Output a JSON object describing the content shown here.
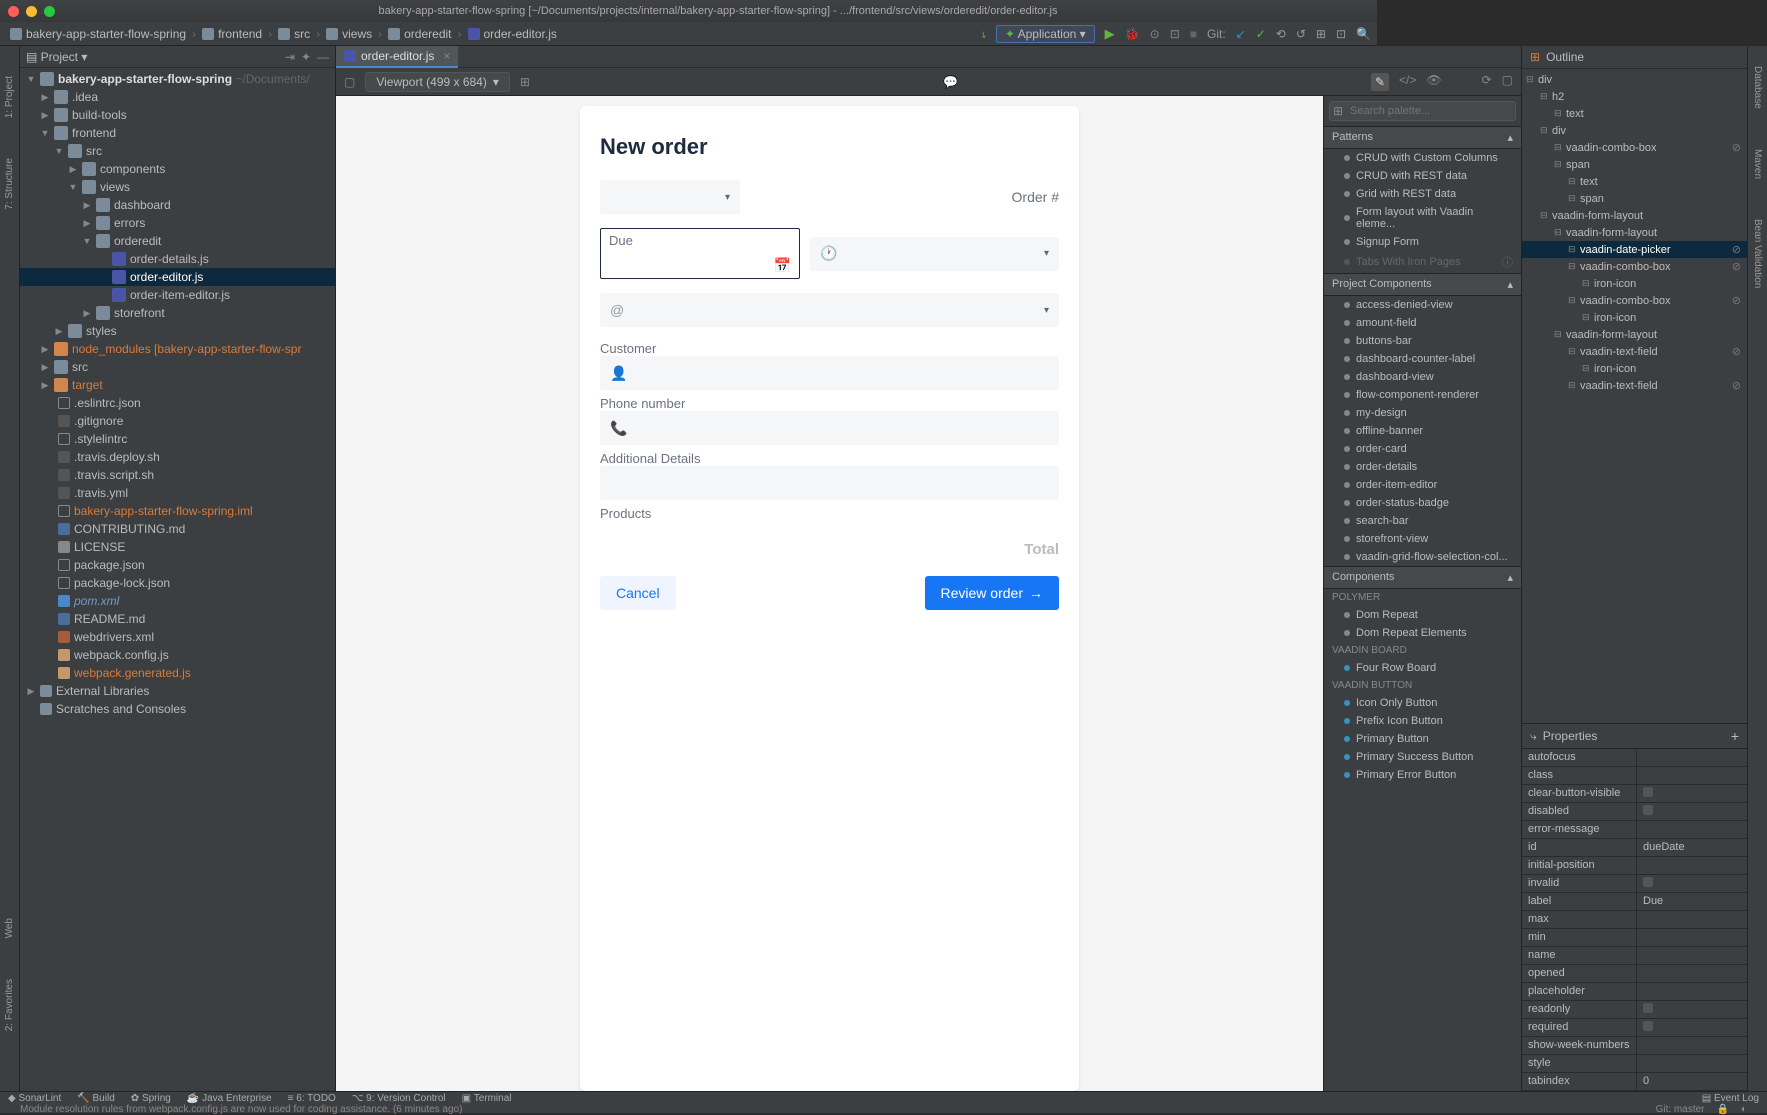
{
  "title": "bakery-app-starter-flow-spring [~/Documents/projects/internal/bakery-app-starter-flow-spring] - .../frontend/src/views/orderedit/order-editor.js",
  "breadcrumb": [
    "bakery-app-starter-flow-spring",
    "frontend",
    "src",
    "views",
    "orderedit",
    "order-editor.js"
  ],
  "run_config": "Application",
  "git_label": "Git:",
  "projectTool": "Project",
  "tree": {
    "root": "bakery-app-starter-flow-spring",
    "rootDim": "~/Documents/",
    "idea": ".idea",
    "buildtools": "build-tools",
    "frontend": "frontend",
    "src": "src",
    "components": "components",
    "views": "views",
    "dashboard": "dashboard",
    "errors": "errors",
    "orderedit": "orderedit",
    "orderdetails": "order-details.js",
    "ordereditor": "order-editor.js",
    "orderitemeditor": "order-item-editor.js",
    "storefront": "storefront",
    "styles": "styles",
    "nodemodules": "node_modules [bakery-app-starter-flow-spr",
    "src2": "src",
    "target": "target",
    "eslintrc": ".eslintrc.json",
    "gitignore": ".gitignore",
    "stylelintrc": ".stylelintrc",
    "travisdeploy": ".travis.deploy.sh",
    "travisscript": ".travis.script.sh",
    "travisyml": ".travis.yml",
    "bakeryiml": "bakery-app-starter-flow-spring.iml",
    "contributing": "CONTRIBUTING.md",
    "license": "LICENSE",
    "packagejson": "package.json",
    "packagelock": "package-lock.json",
    "pom": "pom.xml",
    "readme": "README.md",
    "webdrivers": "webdrivers.xml",
    "webpackconfig": "webpack.config.js",
    "webpackgen": "webpack.generated.js",
    "extlib": "External Libraries",
    "scratches": "Scratches and Consoles"
  },
  "editorTab": "order-editor.js",
  "viewport": "Viewport (499 x 684)",
  "form": {
    "title": "New order",
    "orderId": "Order #",
    "due": "Due",
    "customer": "Customer",
    "phone": "Phone number",
    "details": "Additional Details",
    "products": "Products",
    "total": "Total",
    "cancel": "Cancel",
    "review": "Review order"
  },
  "palette": {
    "search": "Search palette...",
    "secPatterns": "Patterns",
    "patterns": [
      "CRUD with Custom Columns",
      "CRUD with REST data",
      "Grid with REST data",
      "Form layout with Vaadin eleme...",
      "Signup Form",
      "Tabs With Iron Pages"
    ],
    "secProject": "Project Components",
    "project": [
      "access-denied-view",
      "amount-field",
      "buttons-bar",
      "dashboard-counter-label",
      "dashboard-view",
      "flow-component-renderer",
      "my-design",
      "offline-banner",
      "order-card",
      "order-details",
      "order-item-editor",
      "order-status-badge",
      "search-bar",
      "storefront-view",
      "vaadin-grid-flow-selection-col..."
    ],
    "secComponents": "Components",
    "catPolymer": "POLYMER",
    "polymer": [
      "Dom Repeat",
      "Dom Repeat Elements"
    ],
    "catBoard": "VAADIN BOARD",
    "board": [
      "Four Row Board"
    ],
    "catButton": "VAADIN BUTTON",
    "button": [
      "Icon Only Button",
      "Prefix Icon Button",
      "Primary Button",
      "Primary Success Button",
      "Primary Error Button"
    ]
  },
  "outline": {
    "head": "Outline",
    "items": [
      "div",
      "h2",
      "text",
      "div",
      "vaadin-combo-box",
      "span",
      "text",
      "span",
      "vaadin-form-layout",
      "vaadin-form-layout",
      "vaadin-date-picker",
      "vaadin-combo-box",
      "iron-icon",
      "vaadin-combo-box",
      "iron-icon",
      "vaadin-form-layout",
      "vaadin-text-field",
      "iron-icon",
      "vaadin-text-field"
    ]
  },
  "properties": {
    "head": "Properties",
    "rows": [
      {
        "k": "autofocus",
        "v": ""
      },
      {
        "k": "class",
        "v": ""
      },
      {
        "k": "clear-button-visible",
        "v": "chk"
      },
      {
        "k": "disabled",
        "v": "chk"
      },
      {
        "k": "error-message",
        "v": ""
      },
      {
        "k": "id",
        "v": "dueDate"
      },
      {
        "k": "initial-position",
        "v": ""
      },
      {
        "k": "invalid",
        "v": "chk"
      },
      {
        "k": "label",
        "v": "Due"
      },
      {
        "k": "max",
        "v": ""
      },
      {
        "k": "min",
        "v": ""
      },
      {
        "k": "name",
        "v": ""
      },
      {
        "k": "opened",
        "v": ""
      },
      {
        "k": "placeholder",
        "v": ""
      },
      {
        "k": "readonly",
        "v": "chk"
      },
      {
        "k": "required",
        "v": "chk"
      },
      {
        "k": "show-week-numbers",
        "v": ""
      },
      {
        "k": "style",
        "v": ""
      },
      {
        "k": "tabindex",
        "v": "0"
      }
    ]
  },
  "bottomTools": [
    "SonarLint",
    "Build",
    "Spring",
    "Java Enterprise",
    "6: TODO",
    "9: Version Control",
    "Terminal"
  ],
  "eventLog": "Event Log",
  "statusMsg": "Module resolution rules from webpack.config.js are now used for coding assistance. (6 minutes ago)",
  "gitBranch": "Git: master",
  "rails": {
    "project": "1: Project",
    "structure": "7: Structure",
    "favorites": "2: Favorites",
    "web": "Web",
    "database": "Database",
    "maven": "Maven",
    "bean": "Bean Validation"
  }
}
